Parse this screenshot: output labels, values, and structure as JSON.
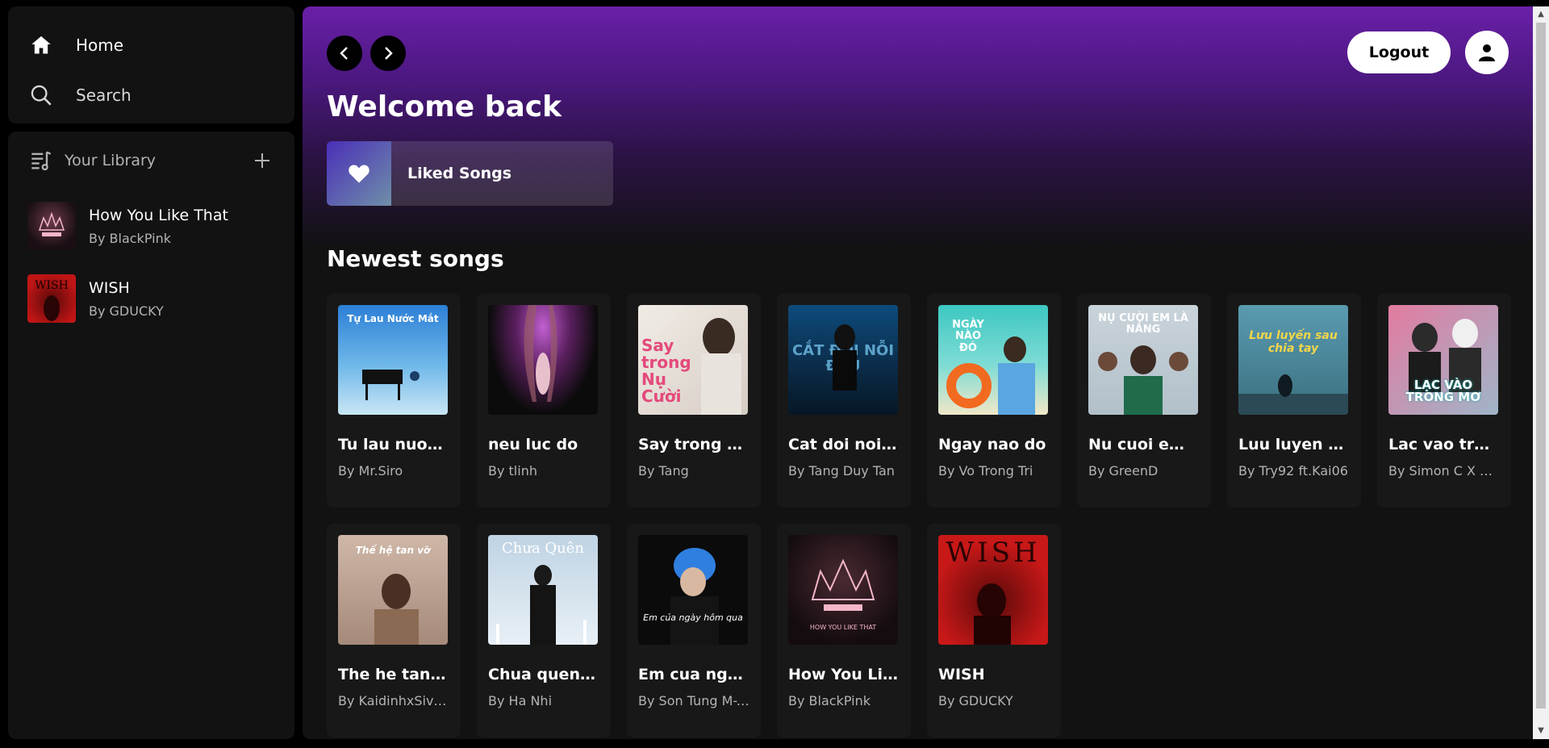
{
  "sidebar": {
    "home_label": "Home",
    "search_label": "Search",
    "library_label": "Your Library",
    "library_items": [
      {
        "title": "How You Like That",
        "artist": "By BlackPink"
      },
      {
        "title": "WISH",
        "artist": "By GDUCKY"
      }
    ]
  },
  "header": {
    "logout_label": "Logout",
    "welcome": "Welcome back",
    "liked_songs": "Liked Songs"
  },
  "section": {
    "newest_title": "Newest songs"
  },
  "songs": [
    {
      "title": "Tu lau nuoc mat",
      "artist": "By Mr.Siro",
      "cover_text": "Tự Lau Nước Mắt"
    },
    {
      "title": "neu luc do",
      "artist": "By tlinh",
      "cover_text": ""
    },
    {
      "title": "Say trong nu cuoi",
      "artist": "By Tang",
      "cover_text": "Say trong Nụ Cười"
    },
    {
      "title": "Cat doi noi sau",
      "artist": "By Tang Duy Tan",
      "cover_text": "CẮT ĐÔI NỖI ĐAU"
    },
    {
      "title": "Ngay nao do",
      "artist": "By Vo Trong Tri",
      "cover_text": "NGÀY NÀO ĐÓ"
    },
    {
      "title": "Nu cuoi em la nang",
      "artist": "By GreenD",
      "cover_text": "NỤ CƯỜI EM LÀ NẮNG"
    },
    {
      "title": "Luu luyen sau chia tay",
      "artist": "By Try92 ft.Kai06",
      "cover_text": "Lưu luyến sau chia tay"
    },
    {
      "title": "Lac vao trong mo",
      "artist": "By Simon C X Wuy",
      "cover_text": "LẠC VÀO TRONG MƠ"
    },
    {
      "title": "The he tan vo",
      "artist": "By KaidinhxSivan",
      "cover_text": "Thế hệ tan vỡ"
    },
    {
      "title": "Chua quen nguoi yeu cu",
      "artist": "By Ha Nhi",
      "cover_text": "Chưa Quên"
    },
    {
      "title": "Em cua ngay hom qua",
      "artist": "By Son Tung M-TP",
      "cover_text": "Em của ngày hôm qua"
    },
    {
      "title": "How You Like That",
      "artist": "By BlackPink",
      "cover_text": "HOW YOU LIKE THAT"
    },
    {
      "title": "WISH",
      "artist": "By GDUCKY",
      "cover_text": "WISH"
    }
  ],
  "colors": {
    "accent_purple": "#6a1fa8",
    "background": "#121212",
    "card": "#181818",
    "subtext": "#b3b3b3"
  },
  "icons": {
    "home": "home-icon",
    "search": "search-icon",
    "library": "library-icon",
    "plus": "plus-icon",
    "back": "chevron-left-icon",
    "forward": "chevron-right-icon",
    "user": "user-icon",
    "heart": "heart-icon"
  }
}
